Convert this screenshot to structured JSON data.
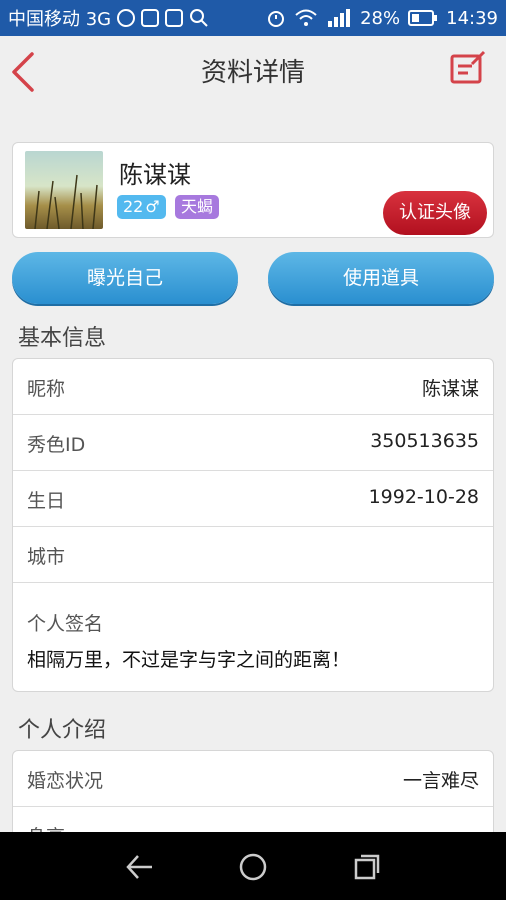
{
  "status_bar": {
    "carrier": "中国移动 3G",
    "battery": "28%",
    "time": "14:39"
  },
  "header": {
    "title": "资料详情",
    "back_icon": "chevron-left-icon",
    "edit_icon": "edit-icon",
    "accent": "#d4434a"
  },
  "profile": {
    "name": "陈谋谋",
    "age": "22",
    "gender_symbol": "♂",
    "zodiac": "天蝎",
    "verify_avatar_label": "认证头像"
  },
  "actions": {
    "expose_label": "曝光自己",
    "use_props_label": "使用道具"
  },
  "basic_info": {
    "section_title": "基本信息",
    "nickname_label": "昵称",
    "nickname_value": "陈谋谋",
    "id_label": "秀色ID",
    "id_value": "350513635",
    "birthday_label": "生日",
    "birthday_value": "1992-10-28",
    "city_label": "城市",
    "city_value": "",
    "signature_label": "个人签名",
    "signature_value": "相隔万里，不过是字与字之间的距离！"
  },
  "intro": {
    "section_title": "个人介绍",
    "marital_label": "婚恋状况",
    "marital_value": "一言难尽",
    "height_label": "身高"
  },
  "colors": {
    "status_bar": "#1f5aa8",
    "button_blue": "#3a9ad6",
    "verify_red": "#c11e2c",
    "age_badge": "#53b9ef",
    "zodiac_badge": "#a779de"
  }
}
